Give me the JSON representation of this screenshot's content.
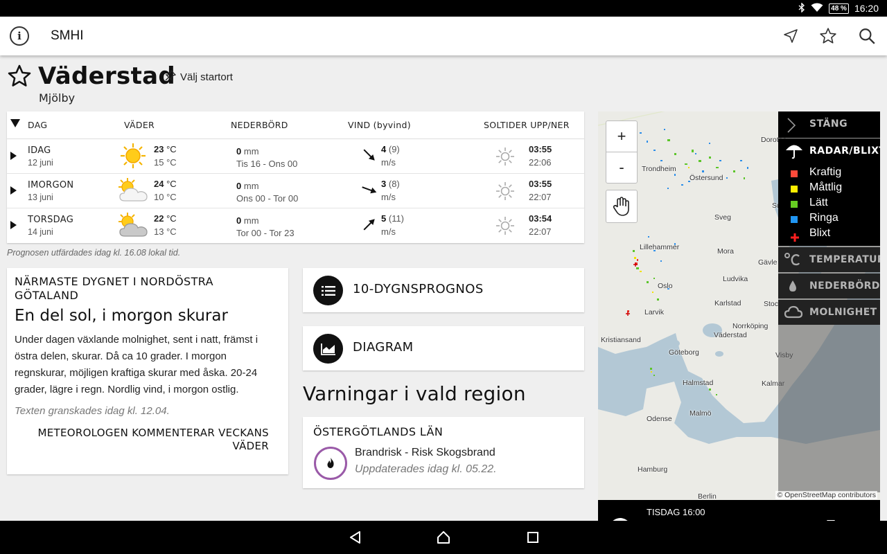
{
  "status": {
    "battery": "48 %",
    "time": "16:20"
  },
  "app": {
    "title": "SMHI"
  },
  "header": {
    "place": "Väderstad",
    "subtitle": "Mjölby",
    "start_location": "Välj startort"
  },
  "forecast": {
    "columns": {
      "day": "DAG",
      "weather": "VÄDER",
      "precip": "NEDERBÖRD",
      "wind": "VIND (byvind)",
      "sun": "SOLTIDER UPP/NER"
    },
    "rows": [
      {
        "day": "IDAG",
        "date": "12 juni",
        "icon": "sunny-icon",
        "tmax": "23",
        "tmin": "15",
        "unit": "°C",
        "precip": "0",
        "precip_unit": "mm",
        "precip_period": "Tis 16 - Ons 00",
        "wind": "4",
        "gust": "(9)",
        "wind_unit": "m/s",
        "wind_dir": "south-east",
        "sunrise": "03:55",
        "sunset": "22:06"
      },
      {
        "day": "IMORGON",
        "date": "13 juni",
        "icon": "partly-cloudy-icon",
        "tmax": "24",
        "tmin": "10",
        "unit": "°C",
        "precip": "0",
        "precip_unit": "mm",
        "precip_period": "Ons 00 - Tor 00",
        "wind": "3",
        "gust": "(8)",
        "wind_unit": "m/s",
        "wind_dir": "east-south-east",
        "sunrise": "03:55",
        "sunset": "22:07"
      },
      {
        "day": "TORSDAG",
        "date": "14 juni",
        "icon": "sun-cloud-icon",
        "tmax": "22",
        "tmin": "13",
        "unit": "°C",
        "precip": "0",
        "precip_unit": "mm",
        "precip_period": "Tor 00 - Tor 23",
        "wind": "5",
        "gust": "(11)",
        "wind_unit": "m/s",
        "wind_dir": "north-east",
        "sunrise": "03:54",
        "sunset": "22:07"
      }
    ],
    "issued": "Prognosen utfärdades idag kl. 16.08 lokal tid."
  },
  "text_forecast": {
    "heading": "NÄRMASTE DYGNET I NORDÖSTRA GÖTALAND",
    "headline": "En del sol, i morgon skurar",
    "body": "Under dagen växlande molnighet, sent i natt, främst i östra delen, skurar. Då ca 10 grader. I morgon regnskurar, möjligen kraftiga skurar med åska. 20-24 grader, lägre i regn. Nordlig vind, i morgon ostlig.",
    "reviewed": "Texten granskades idag kl. 12.04.",
    "link": "METEOROLOGEN KOMMENTERAR VECKANS VÄDER"
  },
  "buttons": {
    "ten_day": "10-DYGNSPROGNOS",
    "diagram": "DIAGRAM"
  },
  "warnings": {
    "title": "Varningar i vald region",
    "region": "ÖSTERGÖTLANDS LÄN",
    "item": "Brandrisk - Risk Skogsbrand",
    "updated": "Uppdaterades idag kl. 05.22.",
    "accent": "#9a5aa8"
  },
  "map": {
    "zoom_in": "+",
    "zoom_out": "-",
    "attribution": "© OpenStreetMap contributors",
    "places": [
      "Dorotea",
      "Trondheim",
      "Östersund",
      "Sundsv",
      "Sveg",
      "Lillehammer",
      "Mora",
      "Gävle",
      "Oslo",
      "Ludvika",
      "Larvik",
      "Karlstad",
      "Stoc",
      "Norrköping",
      "Väderstad",
      "Kristiansand",
      "Göteborg",
      "Visby",
      "Halmstad",
      "Kalmar",
      "Malmö",
      "Odense",
      "Hamburg",
      "Berlin"
    ],
    "legend": {
      "close": "STÄNG",
      "radar": "RADAR/BLIXT",
      "items": [
        {
          "label": "Kraftig",
          "color": "#ff4a3a"
        },
        {
          "label": "Måttlig",
          "color": "#ffee00"
        },
        {
          "label": "Lätt",
          "color": "#66cc22"
        },
        {
          "label": "Ringa",
          "color": "#2196f3"
        },
        {
          "label": "Blixt",
          "color": "#ff2020"
        }
      ],
      "temperature": "TEMPERATUR",
      "precipitation": "NEDERBÖRD",
      "cloudiness": "MOLNIGHET"
    },
    "timestamp": "TISDAG 16:00"
  }
}
